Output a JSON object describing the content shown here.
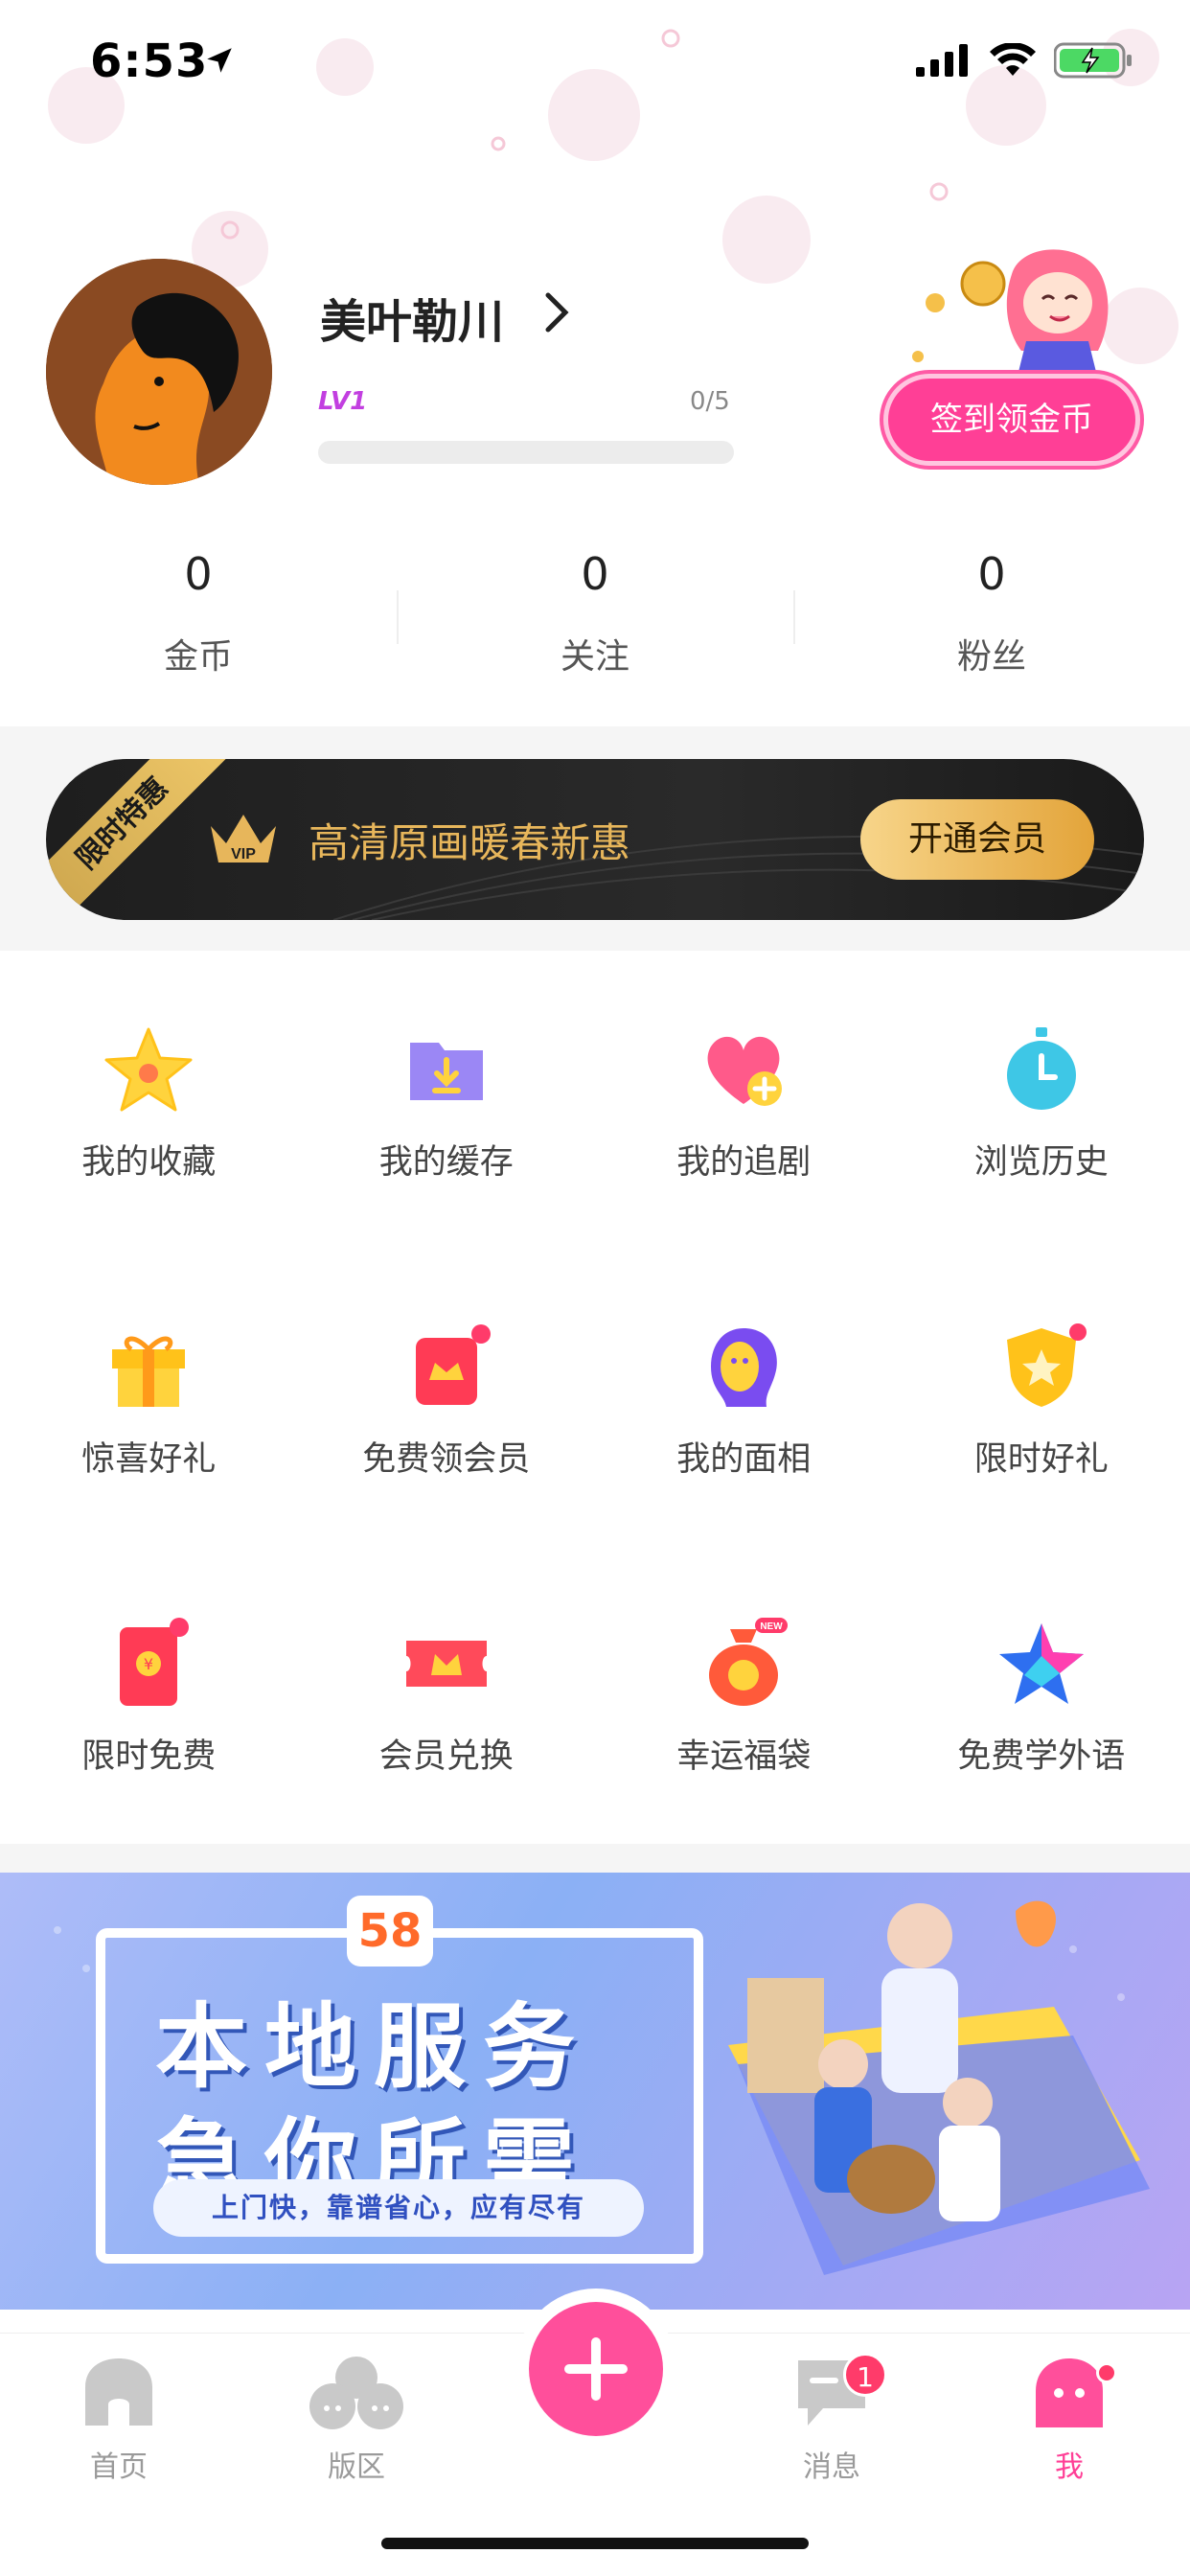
{
  "status_bar": {
    "time": "6:53",
    "icons": [
      "location-arrow-icon",
      "cellular-signal-icon",
      "wifi-icon",
      "battery-charging-icon"
    ]
  },
  "profile": {
    "username": "美叶勒川",
    "level": "LV1",
    "level_progress": "0/5",
    "level_fraction": 0,
    "checkin_label": "签到领金币"
  },
  "stats": [
    {
      "value": "0",
      "label": "金币"
    },
    {
      "value": "0",
      "label": "关注"
    },
    {
      "value": "0",
      "label": "粉丝"
    }
  ],
  "vip_banner": {
    "ribbon": "限时特惠",
    "text": "高清原画暖春新惠",
    "button": "开通会员"
  },
  "grid": [
    {
      "label": "我的收藏",
      "icon": "star-icon"
    },
    {
      "label": "我的缓存",
      "icon": "download-folder-icon"
    },
    {
      "label": "我的追剧",
      "icon": "heart-plus-icon"
    },
    {
      "label": "浏览历史",
      "icon": "clock-icon"
    },
    {
      "label": "惊喜好礼",
      "icon": "gift-box-icon"
    },
    {
      "label": "免费领会员",
      "icon": "crown-bag-icon"
    },
    {
      "label": "我的面相",
      "icon": "face-reading-icon"
    },
    {
      "label": "限时好礼",
      "icon": "shield-star-icon"
    },
    {
      "label": "限时免费",
      "icon": "red-envelope-icon"
    },
    {
      "label": "会员兑换",
      "icon": "crown-ticket-icon"
    },
    {
      "label": "幸运福袋",
      "icon": "lucky-bag-icon"
    },
    {
      "label": "免费学外语",
      "icon": "sparkle-star-icon"
    }
  ],
  "ad_banner": {
    "logo": "58",
    "line1": "本地服务",
    "line2": "急你所需",
    "sub": "上门快，靠谱省心，应有尽有"
  },
  "tab_bar": {
    "tabs": [
      {
        "label": "首页",
        "icon": "home-icon"
      },
      {
        "label": "版区",
        "icon": "board-icon"
      },
      {
        "label": "消息",
        "icon": "message-icon",
        "badge": "1"
      },
      {
        "label": "我",
        "icon": "ghost-profile-icon"
      }
    ],
    "fab_icon": "plus-icon",
    "colors": {
      "active": "#ff3f96",
      "inactive": "#9a9a9a"
    }
  }
}
